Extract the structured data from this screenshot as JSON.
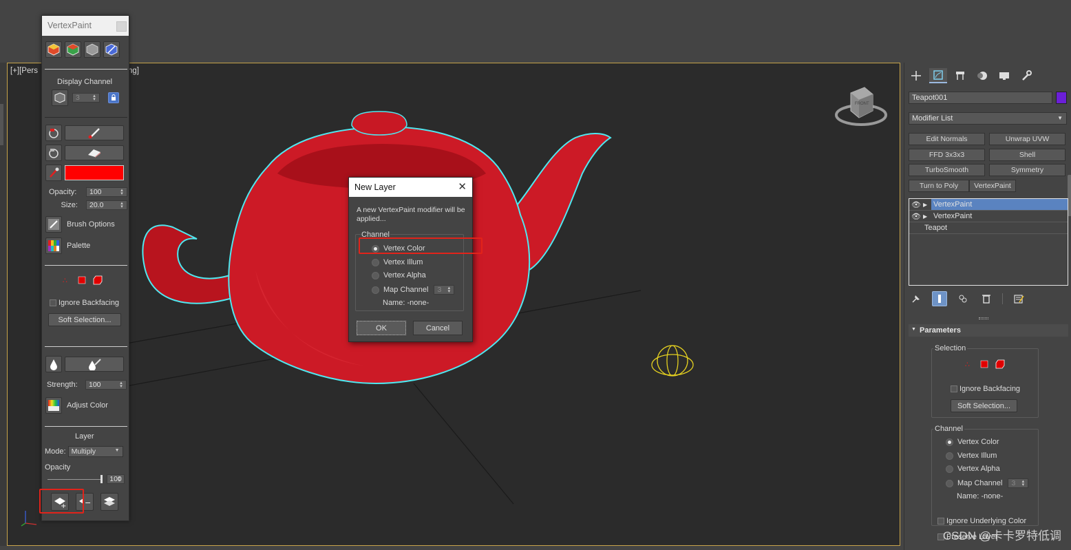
{
  "viewport": {
    "label_visible_left": "[+][Pers",
    "label_visible_right": "fault Shading]",
    "viewcube_face": "FRONT"
  },
  "vertex_paint_panel": {
    "title": "VertexPaint",
    "display_channel_label": "Display Channel",
    "display_channel_value": "3",
    "paint_color": "#ff0000",
    "opacity_label": "Opacity:",
    "opacity_value": "100",
    "size_label": "Size:",
    "size_value": "20.0",
    "brush_options_label": "Brush Options",
    "palette_label": "Palette",
    "ignore_backfacing_label": "Ignore Backfacing",
    "soft_selection_label": "Soft Selection...",
    "strength_label": "Strength:",
    "strength_value": "100",
    "adjust_color_label": "Adjust Color",
    "layer_label": "Layer",
    "mode_label": "Mode:",
    "mode_value": "Multiply",
    "layer_opacity_label": "Opacity",
    "layer_opacity_value": "100"
  },
  "new_layer_dialog": {
    "title": "New Layer",
    "message": "A new VertexPaint modifier will be applied...",
    "channel_group_label": "Channel",
    "options": [
      "Vertex Color",
      "Vertex Illum",
      "Vertex Alpha",
      "Map Channel"
    ],
    "selected_option": "Vertex Color",
    "map_channel_value": "3",
    "name_label": "Name: -none-",
    "ok_label": "OK",
    "cancel_label": "Cancel"
  },
  "command_panel": {
    "object_name": "Teapot001",
    "object_color": "#6b1fd8",
    "modifier_list_label": "Modifier List",
    "modifier_buttons": [
      "Edit Normals",
      "Unwrap UVW",
      "FFD 3x3x3",
      "Shell",
      "TurboSmooth",
      "Symmetry",
      "Turn to Poly",
      "VertexPaint"
    ],
    "stack": [
      {
        "label": "VertexPaint",
        "selected": true
      },
      {
        "label": "VertexPaint",
        "selected": false
      },
      {
        "label": "Teapot",
        "selected": false
      }
    ],
    "parameters_rollout": "Parameters",
    "selection_group": "Selection",
    "ignore_backfacing_label": "Ignore Backfacing",
    "soft_selection_label": "Soft Selection...",
    "channel_group": "Channel",
    "channel_options": [
      "Vertex Color",
      "Vertex Illum",
      "Vertex Alpha",
      "Map Channel"
    ],
    "channel_selected": "Vertex Color",
    "map_channel_value": "3",
    "name_label": "Name: -none-",
    "ignore_underlying_label": "Ignore Underlying Color",
    "preserve_layer_label": "Preserve Layer"
  },
  "watermark": "CSDN @卡卡罗特低调"
}
